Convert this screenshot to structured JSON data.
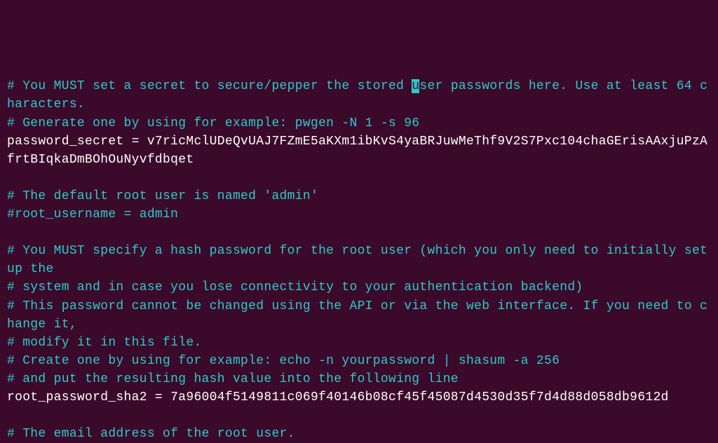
{
  "lines": {
    "c1a": "# You MUST set a secret to secure/pepper the stored ",
    "c1b": "u",
    "c1c": "ser passwords here. Use at least 64 characters.",
    "c2": "# Generate one by using for example: pwgen -N 1 -s 96",
    "v1": "password_secret = v7ricMclUDeQvUAJ7FZmE5aKXm1ibKvS4yaBRJuwMeThf9V2S7Pxc104chaGErisAAxjuPzAfrtBIqkaDmBOhOuNyvfdbqet",
    "c3": "# The default root user is named 'admin'",
    "c4": "#root_username = admin",
    "c5": "# You MUST specify a hash password for the root user (which you only need to initially set up the",
    "c6": "# system and in case you lose connectivity to your authentication backend)",
    "c7": "# This password cannot be changed using the API or via the web interface. If you need to change it,",
    "c8": "# modify it in this file.",
    "c9": "# Create one by using for example: echo -n yourpassword | shasum -a 256",
    "c10": "# and put the resulting hash value into the following line",
    "v2": "root_password_sha2 = 7a96004f5149811c069f40146b08cf45f45087d4530d35f7d4d88d058db9612d",
    "c11": "# The email address of the root user."
  }
}
